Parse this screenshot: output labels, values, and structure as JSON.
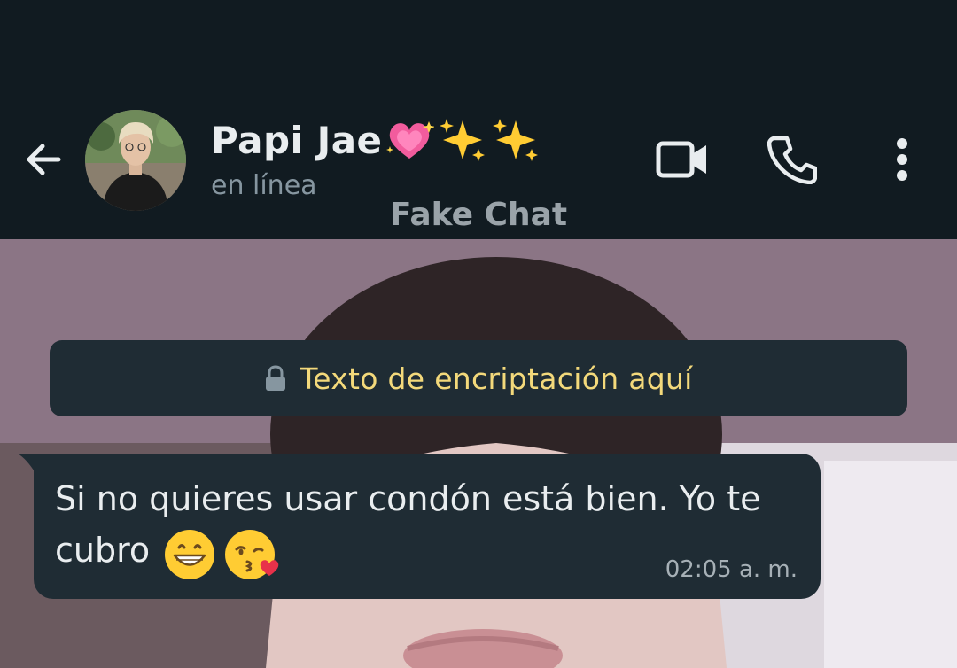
{
  "header": {
    "contact_name": "Papi Jae",
    "name_emojis": [
      "growing-heart-emoji",
      "sparkles-emoji",
      "sparkles-emoji"
    ],
    "status": "en línea",
    "watermark": "Fake Chat",
    "icons": [
      "arrow-left-icon",
      "video-camera-icon",
      "phone-icon",
      "more-vert-icon"
    ]
  },
  "chat": {
    "encryption_notice": "Texto de encriptación aquí",
    "messages": [
      {
        "direction": "incoming",
        "text_line1": "Si no quieres usar condón está bien. Yo te",
        "text_line2": "cubro",
        "emojis": [
          "grinning-emoji",
          "kissing-heart-emoji"
        ],
        "time": "02:05 a. m."
      }
    ]
  },
  "colors": {
    "header_bg": "#111b21",
    "bubble_bg": "#1f2c34",
    "primary_text": "#e9edef",
    "secondary_text": "#8696a0",
    "encryption_text": "#f3d97b"
  }
}
